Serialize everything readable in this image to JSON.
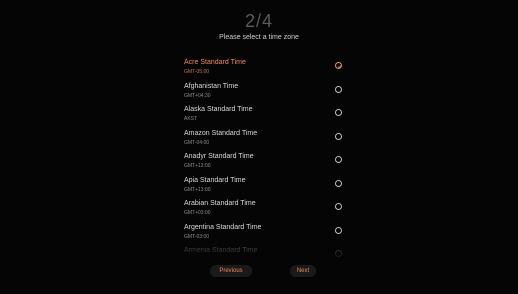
{
  "header": {
    "step": "2/4",
    "subtitle": "Please select a time zone"
  },
  "timezones": [
    {
      "name": "Acre Standard Time",
      "offset": "GMT-05:00",
      "selected": true
    },
    {
      "name": "Afghanistan Time",
      "offset": "GMT+04:30",
      "selected": false
    },
    {
      "name": "Alaska Standard Time",
      "offset": "AKST",
      "selected": false
    },
    {
      "name": "Amazon Standard Time",
      "offset": "GMT-04:00",
      "selected": false
    },
    {
      "name": "Anadyr Standard Time",
      "offset": "GMT+12:00",
      "selected": false
    },
    {
      "name": "Apia Standard Time",
      "offset": "GMT+13:00",
      "selected": false
    },
    {
      "name": "Arabian Standard Time",
      "offset": "GMT+03:00",
      "selected": false
    },
    {
      "name": "Argentina Standard Time",
      "offset": "GMT-03:00",
      "selected": false
    },
    {
      "name": "Armenia Standard Time",
      "offset": "",
      "selected": false
    }
  ],
  "buttons": {
    "previous": "Previous",
    "next": "Next"
  },
  "colors": {
    "accent": "#f08a5d",
    "background": "#050505"
  },
  "icons": {
    "selected": "check-circle-icon",
    "unselected": "radio-empty-icon"
  }
}
